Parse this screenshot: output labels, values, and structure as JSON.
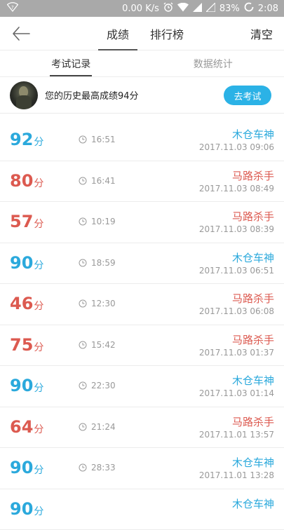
{
  "status_bar": {
    "speed": "0.00 K/s",
    "battery": "83%",
    "time": "2:08"
  },
  "header": {
    "tabs": [
      {
        "label": "成绩",
        "active": true
      },
      {
        "label": "排行榜",
        "active": false
      }
    ],
    "clear_label": "清空"
  },
  "subtabs": [
    {
      "label": "考试记录",
      "active": true
    },
    {
      "label": "数据统计",
      "active": false
    }
  ],
  "best": {
    "text": "您的历史最高成绩94分",
    "button_label": "去考试"
  },
  "unit": "分",
  "colors": {
    "accent_blue": "#2ba9dc",
    "accent_red": "#dc5a50",
    "button_blue": "#2bb2e6"
  },
  "records": [
    {
      "score": "92",
      "color": "blue",
      "duration": "16:51",
      "title": "木仓车神",
      "date": "2017.11.03 09:06"
    },
    {
      "score": "80",
      "color": "red",
      "duration": "16:41",
      "title": "马路杀手",
      "date": "2017.11.03 08:49"
    },
    {
      "score": "57",
      "color": "red",
      "duration": "10:19",
      "title": "马路杀手",
      "date": "2017.11.03 08:39"
    },
    {
      "score": "90",
      "color": "blue",
      "duration": "18:59",
      "title": "木仓车神",
      "date": "2017.11.03 06:51"
    },
    {
      "score": "46",
      "color": "red",
      "duration": "12:30",
      "title": "马路杀手",
      "date": "2017.11.03 06:08"
    },
    {
      "score": "75",
      "color": "red",
      "duration": "15:42",
      "title": "马路杀手",
      "date": "2017.11.03 01:37"
    },
    {
      "score": "90",
      "color": "blue",
      "duration": "22:30",
      "title": "木仓车神",
      "date": "2017.11.03 01:14"
    },
    {
      "score": "64",
      "color": "red",
      "duration": "21:24",
      "title": "马路杀手",
      "date": "2017.11.01 13:57"
    },
    {
      "score": "90",
      "color": "blue",
      "duration": "28:33",
      "title": "木仓车神",
      "date": "2017.11.01 13:28"
    },
    {
      "score": "90",
      "color": "blue",
      "duration": "",
      "title": "木仓车神",
      "date": ""
    }
  ]
}
